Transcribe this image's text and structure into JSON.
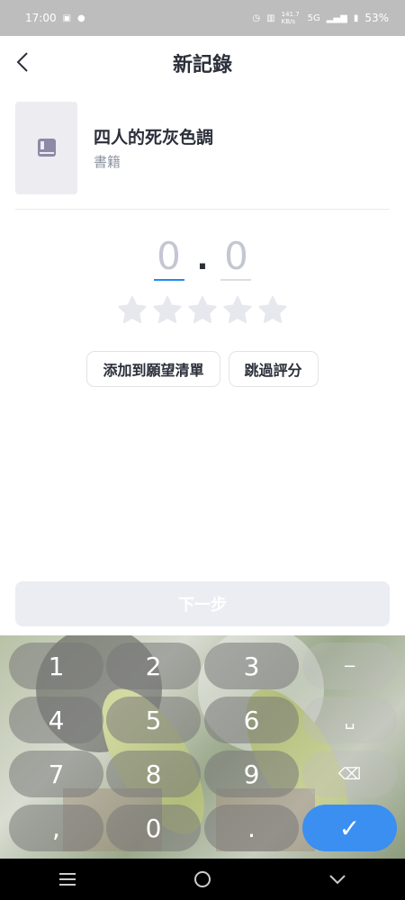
{
  "status_bar": {
    "time": "17:00",
    "speed": "141.7 KB/s",
    "network": "5G",
    "battery": "53%"
  },
  "header": {
    "title": "新記錄"
  },
  "item": {
    "title": "四人的死灰色調",
    "type": "書籍"
  },
  "rating": {
    "whole": "0",
    "separator": ".",
    "decimal": "0",
    "stars_filled": 0,
    "stars_total": 5
  },
  "actions": {
    "wishlist": "添加到願望清單",
    "skip": "跳過評分"
  },
  "next_button": {
    "label": "下一步"
  },
  "keyboard": {
    "row1": [
      "1",
      "2",
      "3",
      "−"
    ],
    "row2": [
      "4",
      "5",
      "6",
      "␣"
    ],
    "row3": [
      "7",
      "8",
      "9",
      "⌫"
    ],
    "row4": [
      ",",
      "0",
      ".",
      "✓"
    ]
  },
  "colors": {
    "accent": "#1f8cf0",
    "confirm_key": "#3b8ff0",
    "star_empty": "#e6e8ee"
  }
}
